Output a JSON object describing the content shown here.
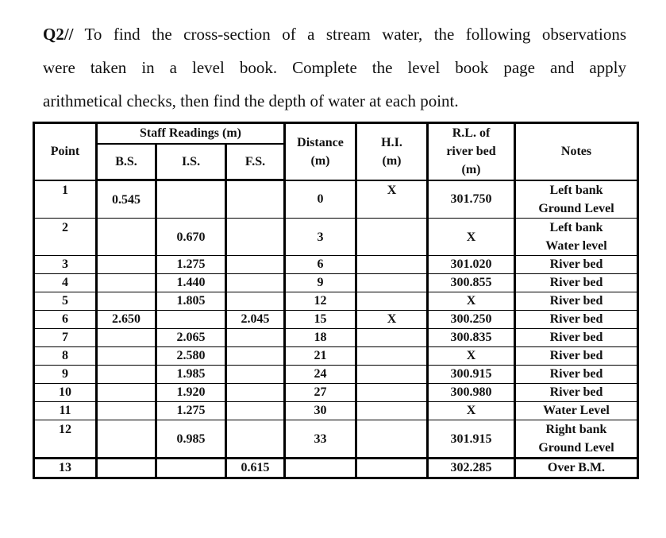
{
  "question": {
    "number": "Q2//",
    "lines": [
      " To find the cross-section of a stream water, the following observations",
      "were taken in a level book. Complete the level book page and apply",
      "arithmetical checks, then find the depth of water at each point."
    ]
  },
  "table": {
    "headers": {
      "point": "Point",
      "staff_readings": "Staff Readings (m)",
      "bs": "B.S.",
      "is": "I.S.",
      "fs": "F.S.",
      "distance_line1": "Distance",
      "distance_line2": "(m)",
      "hi_line1": "H.I.",
      "hi_line2": "(m)",
      "rl_line1": "R.L. of",
      "rl_line2": "river bed",
      "rl_line3": "(m)",
      "notes": "Notes"
    },
    "rows": [
      {
        "point": "1",
        "bs": "0.545",
        "is": "",
        "fs": "",
        "distance": "0",
        "hi": "X",
        "rl": "301.750",
        "notes_line1": "Left bank",
        "notes_line2": "Ground Level"
      },
      {
        "point": "2",
        "bs": "",
        "is": "0.670",
        "fs": "",
        "distance": "3",
        "hi": "",
        "rl": "X",
        "notes_line1": "Left bank",
        "notes_line2": "Water level"
      },
      {
        "point": "3",
        "bs": "",
        "is": "1.275",
        "fs": "",
        "distance": "6",
        "hi": "",
        "rl": "301.020",
        "notes_line1": "River bed",
        "notes_line2": ""
      },
      {
        "point": "4",
        "bs": "",
        "is": "1.440",
        "fs": "",
        "distance": "9",
        "hi": "",
        "rl": "300.855",
        "notes_line1": "River bed",
        "notes_line2": ""
      },
      {
        "point": "5",
        "bs": "",
        "is": "1.805",
        "fs": "",
        "distance": "12",
        "hi": "",
        "rl": "X",
        "notes_line1": "River bed",
        "notes_line2": ""
      },
      {
        "point": "6",
        "bs": "2.650",
        "is": "",
        "fs": "2.045",
        "distance": "15",
        "hi": "X",
        "rl": "300.250",
        "notes_line1": "River bed",
        "notes_line2": ""
      },
      {
        "point": "7",
        "bs": "",
        "is": "2.065",
        "fs": "",
        "distance": "18",
        "hi": "",
        "rl": "300.835",
        "notes_line1": "River bed",
        "notes_line2": ""
      },
      {
        "point": "8",
        "bs": "",
        "is": "2.580",
        "fs": "",
        "distance": "21",
        "hi": "",
        "rl": "X",
        "notes_line1": "River bed",
        "notes_line2": ""
      },
      {
        "point": "9",
        "bs": "",
        "is": "1.985",
        "fs": "",
        "distance": "24",
        "hi": "",
        "rl": "300.915",
        "notes_line1": "River bed",
        "notes_line2": ""
      },
      {
        "point": "10",
        "bs": "",
        "is": "1.920",
        "fs": "",
        "distance": "27",
        "hi": "",
        "rl": "300.980",
        "notes_line1": "River bed",
        "notes_line2": ""
      },
      {
        "point": "11",
        "bs": "",
        "is": "1.275",
        "fs": "",
        "distance": "30",
        "hi": "",
        "rl": "X",
        "notes_line1": "Water Level",
        "notes_line2": ""
      },
      {
        "point": "12",
        "bs": "",
        "is": "0.985",
        "fs": "",
        "distance": "33",
        "hi": "",
        "rl": "301.915",
        "notes_line1": "Right bank",
        "notes_line2": "Ground Level"
      },
      {
        "point": "13",
        "bs": "",
        "is": "",
        "fs": "0.615",
        "distance": "",
        "hi": "",
        "rl": "302.285",
        "notes_line1": "Over B.M.",
        "notes_line2": ""
      }
    ]
  }
}
